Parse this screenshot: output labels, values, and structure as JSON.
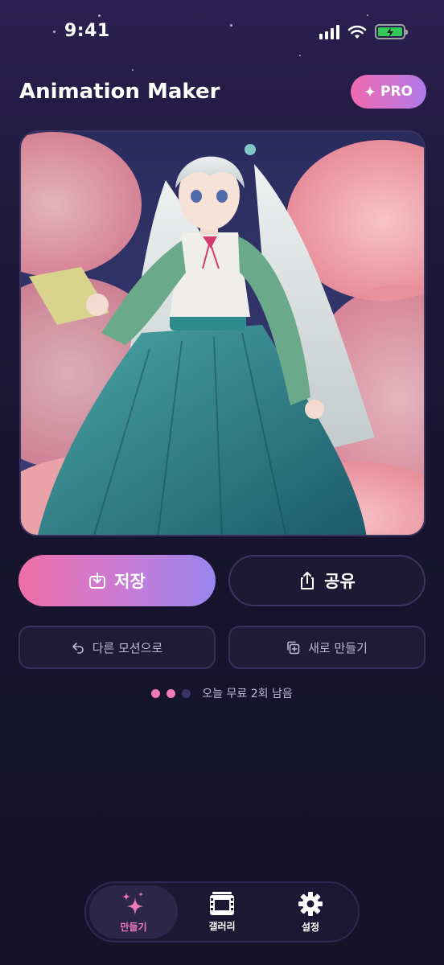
{
  "status_bar": {
    "time": "9:41"
  },
  "header": {
    "title": "Animation Maker",
    "pro_label": "PRO",
    "pro_icon": "sparkle-icon"
  },
  "preview": {
    "image_icon": "anime-girl-illustration"
  },
  "actions": {
    "save_label": "저장",
    "share_label": "공유",
    "other_motion_label": "다른 모션으로",
    "new_label": "새로 만들기"
  },
  "usage": {
    "text": "오늘 무료 2회 남음",
    "used": 2,
    "total": 3
  },
  "tabs": [
    {
      "label": "만들기",
      "icon": "sparkles-icon",
      "active": true
    },
    {
      "label": "갤러리",
      "icon": "film-icon",
      "active": false
    },
    {
      "label": "설정",
      "icon": "gear-icon",
      "active": false
    }
  ],
  "colors": {
    "accent_pink": "#f06fa8",
    "accent_purple": "#9a86f0",
    "background": "#15122a"
  }
}
